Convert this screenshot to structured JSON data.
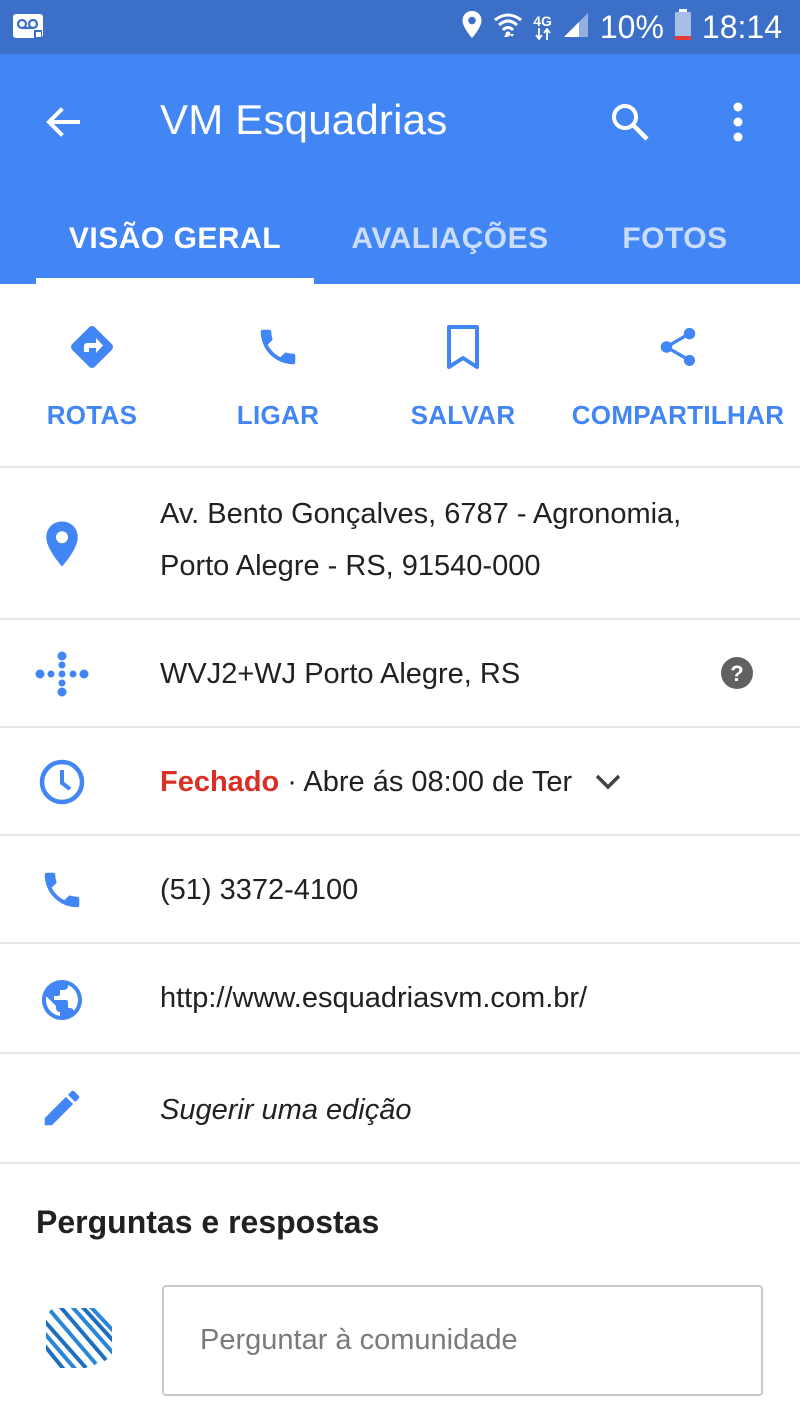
{
  "status_bar": {
    "network": "4G",
    "battery": "10%",
    "time": "18:14"
  },
  "app_bar": {
    "title": "VM Esquadrias"
  },
  "tabs": [
    {
      "label": "VISÃO GERAL",
      "selected": true
    },
    {
      "label": "AVALIAÇÕES",
      "selected": false
    },
    {
      "label": "FOTOS",
      "selected": false
    }
  ],
  "actions": [
    {
      "label": "ROTAS",
      "icon": "directions-icon"
    },
    {
      "label": "LIGAR",
      "icon": "phone-icon"
    },
    {
      "label": "SALVAR",
      "icon": "bookmark-icon"
    },
    {
      "label": "COMPARTILHAR",
      "icon": "share-icon"
    }
  ],
  "info": {
    "address_line1": "Av. Bento Gonçalves, 6787 - Agronomia,",
    "address_line2": "Porto Alegre - RS, 91540-000",
    "plus_code": "WVJ2+WJ Porto Alegre, RS",
    "hours_status": "Fechado",
    "hours_detail": " · Abre ás 08:00 de Ter",
    "phone": "(51) 3372-4100",
    "website": "http://www.esquadriasvm.com.br/",
    "suggest_edit": "Sugerir uma edição"
  },
  "qa": {
    "title": "Perguntas e respostas",
    "placeholder": "Perguntar à comunidade"
  },
  "colors": {
    "status_bar": "#3c6fc8",
    "app_bar": "#4285f4",
    "accent": "#4285f4",
    "closed": "#d93025"
  }
}
